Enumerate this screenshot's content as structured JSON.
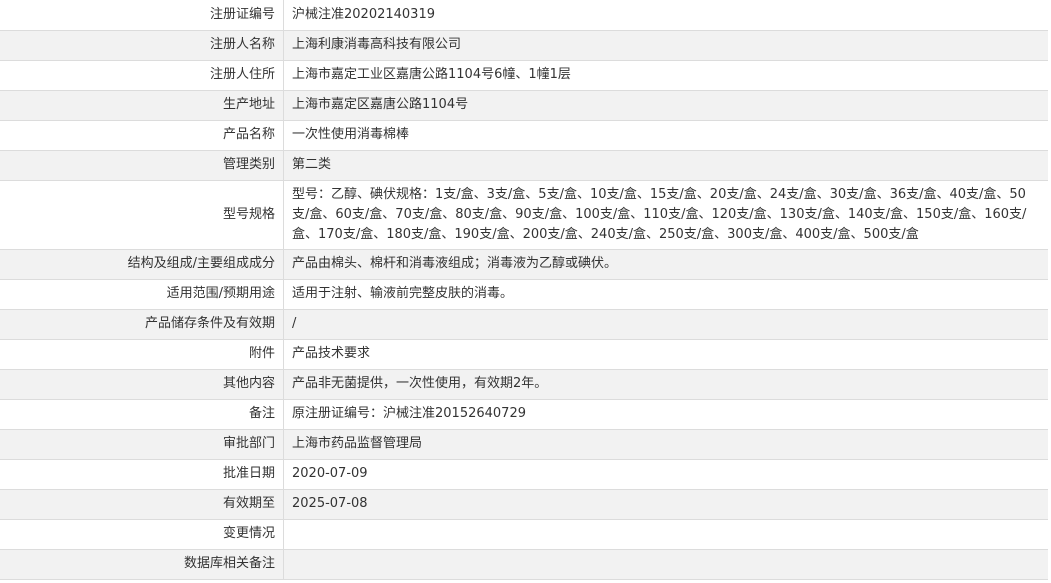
{
  "rows": [
    {
      "label": "注册证编号",
      "value": "沪械注准20202140319"
    },
    {
      "label": "注册人名称",
      "value": "上海利康消毒高科技有限公司"
    },
    {
      "label": "注册人住所",
      "value": "上海市嘉定工业区嘉唐公路1104号6幢、1幢1层"
    },
    {
      "label": "生产地址",
      "value": "上海市嘉定区嘉唐公路1104号"
    },
    {
      "label": "产品名称",
      "value": "一次性使用消毒棉棒"
    },
    {
      "label": "管理类别",
      "value": "第二类"
    },
    {
      "label": "型号规格",
      "value": "型号：乙醇、碘伏规格：1支/盒、3支/盒、5支/盒、10支/盒、15支/盒、20支/盒、24支/盒、30支/盒、36支/盒、40支/盒、50支/盒、60支/盒、70支/盒、80支/盒、90支/盒、100支/盒、110支/盒、120支/盒、130支/盒、140支/盒、150支/盒、160支/盒、170支/盒、180支/盒、190支/盒、200支/盒、240支/盒、250支/盒、300支/盒、400支/盒、500支/盒"
    },
    {
      "label": "结构及组成/主要组成成分",
      "value": "产品由棉头、棉杆和消毒液组成；消毒液为乙醇或碘伏。"
    },
    {
      "label": "适用范围/预期用途",
      "value": "适用于注射、输液前完整皮肤的消毒。"
    },
    {
      "label": "产品储存条件及有效期",
      "value": "/"
    },
    {
      "label": "附件",
      "value": "产品技术要求"
    },
    {
      "label": "其他内容",
      "value": "产品非无菌提供，一次性使用，有效期2年。"
    },
    {
      "label": "备注",
      "value": "原注册证编号：沪械注准20152640729"
    },
    {
      "label": "审批部门",
      "value": "上海市药品监督管理局"
    },
    {
      "label": "批准日期",
      "value": "2020-07-09"
    },
    {
      "label": "有效期至",
      "value": "2025-07-08"
    },
    {
      "label": "变更情况",
      "value": ""
    },
    {
      "label": "数据库相关备注",
      "value": ""
    }
  ]
}
